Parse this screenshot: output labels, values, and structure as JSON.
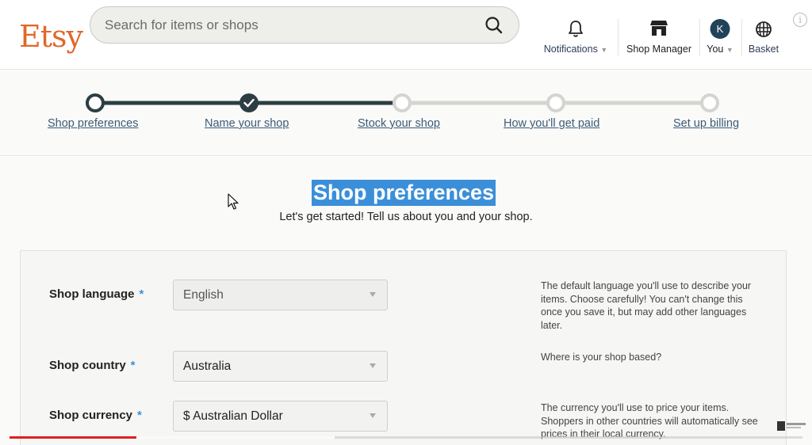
{
  "header": {
    "logo": "Etsy",
    "search_placeholder": "Search for items or shops",
    "nav": {
      "notifications": "Notifications",
      "shop_manager": "Shop Manager",
      "you": "You",
      "avatar_initial": "K",
      "basket": "Basket"
    }
  },
  "steps": [
    {
      "label": "Shop preferences",
      "state": "current"
    },
    {
      "label": "Name your shop",
      "state": "done"
    },
    {
      "label": "Stock your shop",
      "state": "todo"
    },
    {
      "label": "How you'll get paid",
      "state": "todo"
    },
    {
      "label": "Set up billing",
      "state": "todo"
    }
  ],
  "main": {
    "title": "Shop preferences",
    "subtitle": "Let's get started! Tell us about you and your shop."
  },
  "form": {
    "language": {
      "label": "Shop language",
      "required_mark": "*",
      "value": "English",
      "help": "The default language you'll use to describe your items. Choose carefully! You can't change this once you save it, but may add other languages later."
    },
    "country": {
      "label": "Shop country",
      "required_mark": "*",
      "value": "Australia",
      "help": "Where is your shop based?"
    },
    "currency": {
      "label": "Shop currency",
      "required_mark": "*",
      "value": "$ Australian Dollar",
      "help": "The currency you'll use to price your items. Shoppers in other countries will automatically see prices in their local currency."
    }
  },
  "colors": {
    "brand": "#e0682b",
    "accent": "#3b8fd9",
    "link": "#3c5b78",
    "progress_done": "#2c3e44"
  },
  "video_progress": 0.16
}
